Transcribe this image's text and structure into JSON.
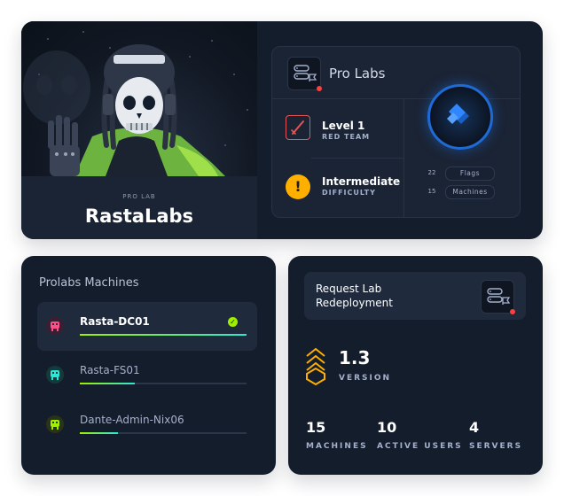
{
  "lab": {
    "kicker": "PRO LAB",
    "name": "RastaLabs",
    "section_title": "Pro Labs",
    "level": {
      "label": "Level 1",
      "sub": "RED TEAM"
    },
    "difficulty": {
      "label": "Intermediate",
      "sub": "DIFFICULTY",
      "icon": "!"
    },
    "stats": [
      {
        "count": "22",
        "label": "Flags"
      },
      {
        "count": "15",
        "label": "Machines"
      }
    ]
  },
  "machines": {
    "title": "Prolabs Machines",
    "items": [
      {
        "name": "Rasta-DC01",
        "progress": 1.0,
        "owned": true,
        "avatar_color": "#ff4f8b"
      },
      {
        "name": "Rasta-FS01",
        "progress": 0.33,
        "owned": false,
        "avatar_color": "#2ee6d6"
      },
      {
        "name": "Dante-Admin-Nix06",
        "progress": 0.23,
        "owned": false,
        "avatar_color": "#9fef00"
      }
    ]
  },
  "redeploy": {
    "label": "Request Lab Redeployment",
    "version": "1.3",
    "version_label": "VERSION",
    "stats": [
      {
        "value": "15",
        "label": "MACHINES"
      },
      {
        "value": "10",
        "label": "ACTIVE USERS"
      },
      {
        "value": "4",
        "label": "SERVERS"
      }
    ]
  },
  "colors": {
    "background": "#141d2b",
    "accent_green": "#9fef00",
    "accent_cyan": "#2ee6d6",
    "accent_red": "#ff3e3e",
    "accent_blue": "#1e6bd6",
    "accent_yellow": "#ffaf00"
  }
}
